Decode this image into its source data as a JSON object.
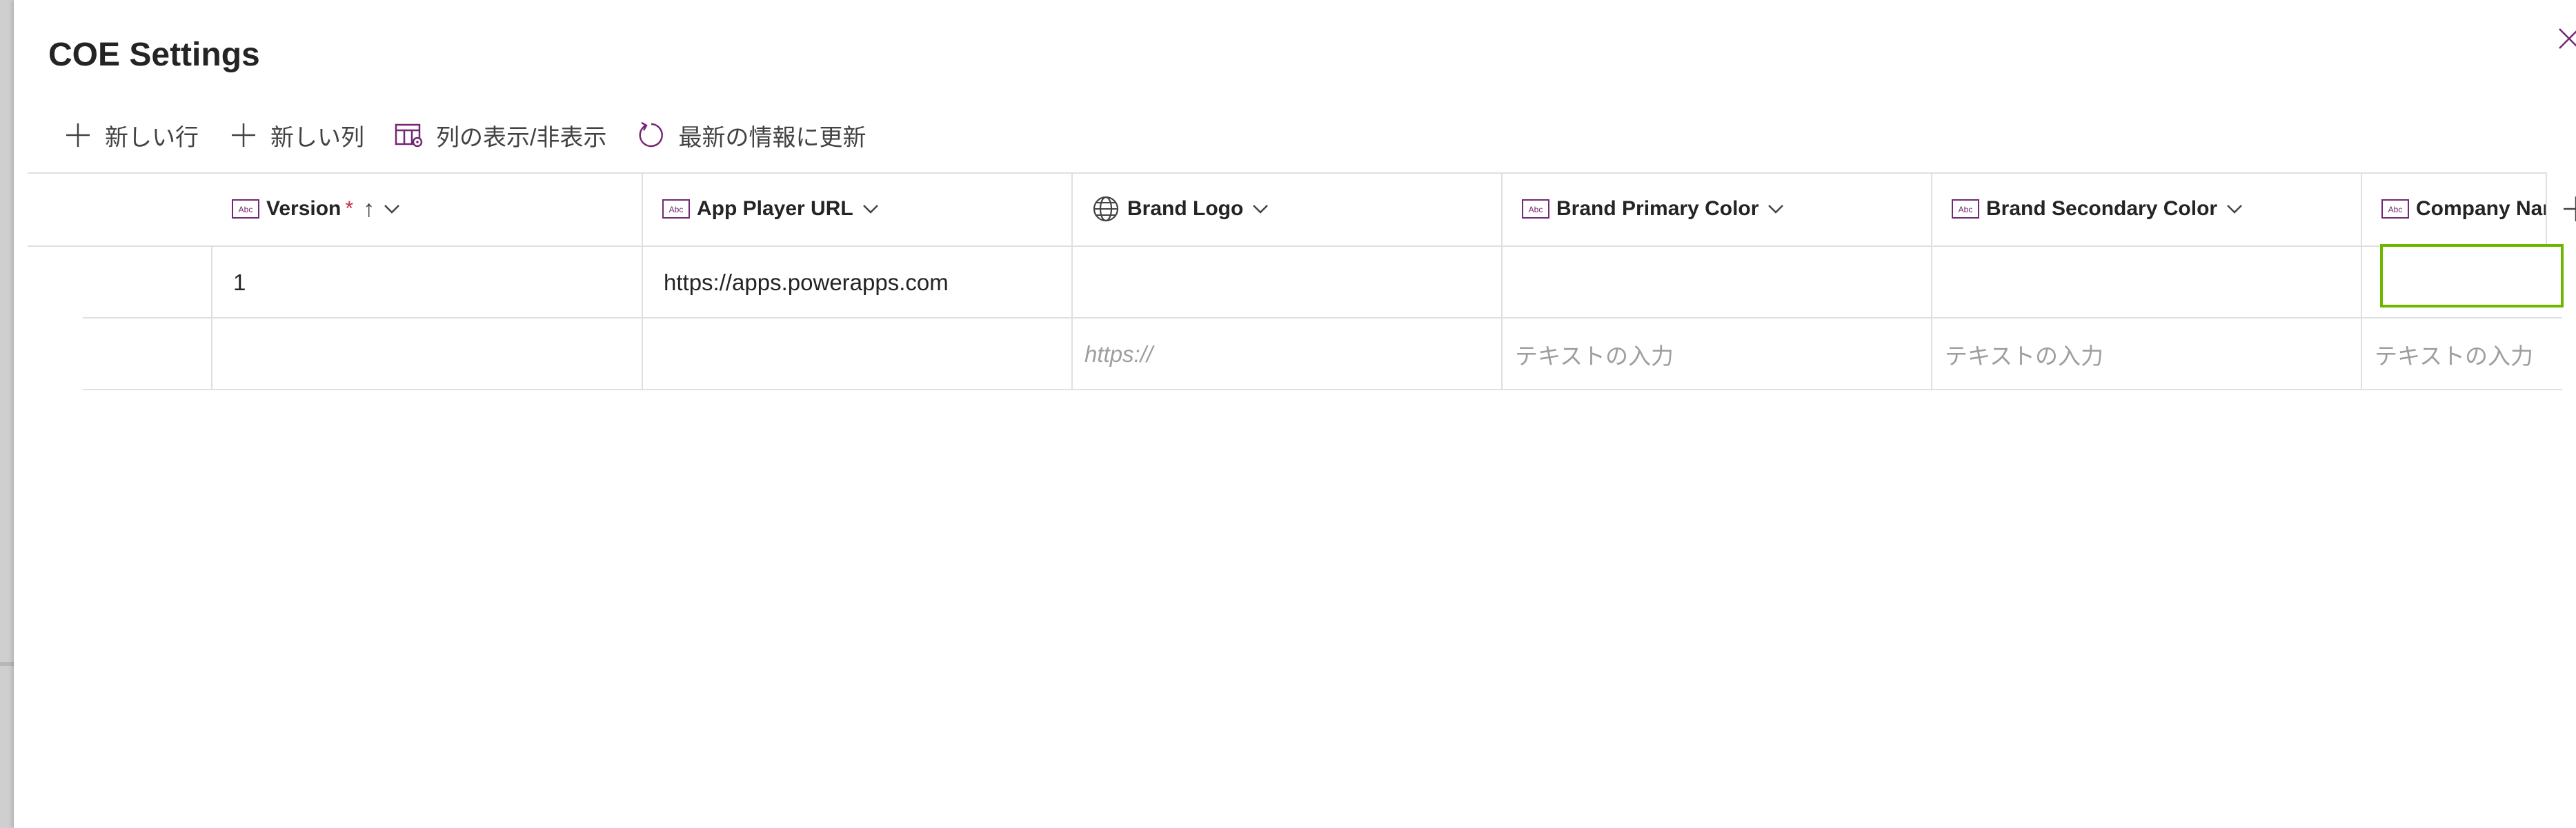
{
  "dialog": {
    "title": "COE Settings"
  },
  "toolbar": {
    "new_row": "新しい行",
    "new_column": "新しい列",
    "show_hide_columns": "列の表示/非表示",
    "refresh": "最新の情報に更新"
  },
  "grid": {
    "columns": [
      {
        "label": "Version",
        "type_icon": "text-field-icon",
        "required": true,
        "sorted": "ascending"
      },
      {
        "label": "App Player URL",
        "type_icon": "text-field-icon"
      },
      {
        "label": "Brand Logo",
        "type_icon": "globe-icon"
      },
      {
        "label": "Brand Primary Color",
        "type_icon": "text-field-icon"
      },
      {
        "label": "Brand Secondary Color",
        "type_icon": "text-field-icon"
      },
      {
        "label": "Company Nar",
        "type_icon": "text-field-icon"
      }
    ],
    "required_marker": "*",
    "sort_marker": "↑",
    "rows": [
      {
        "version": "1",
        "app_player_url": "https://apps.powerapps.com",
        "brand_logo": "",
        "brand_primary_color": "",
        "brand_secondary_color": "",
        "company_name": ""
      }
    ],
    "new_row_placeholders": {
      "url": "https://",
      "text": "テキストの入力",
      "text_truncated": "テキストの入力"
    }
  },
  "colors": {
    "accent_purple": "#742774",
    "selection_green": "#6bb700",
    "required_red": "#c4314b"
  }
}
